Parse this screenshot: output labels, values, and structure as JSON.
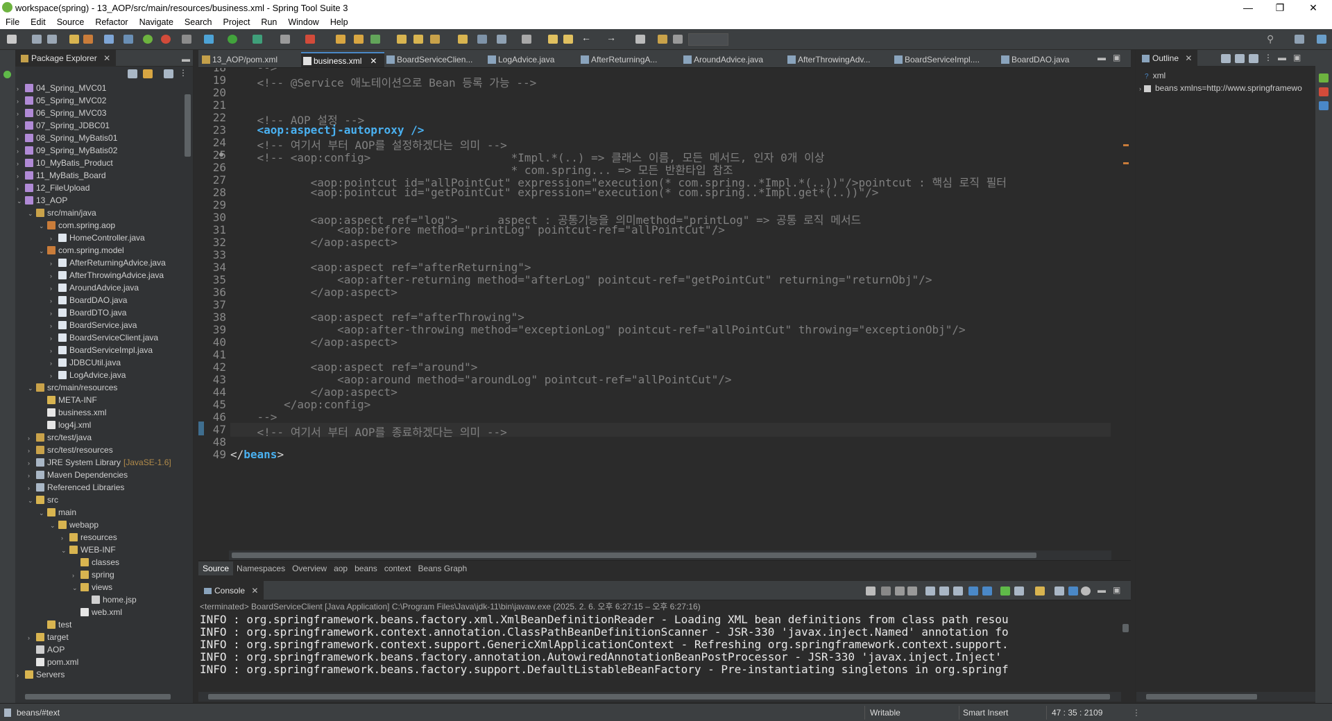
{
  "window": {
    "title": "workspace(spring) - 13_AOP/src/main/resources/business.xml - Spring Tool Suite 3"
  },
  "menu": [
    "File",
    "Edit",
    "Source",
    "Refactor",
    "Navigate",
    "Search",
    "Project",
    "Run",
    "Window",
    "Help"
  ],
  "package_explorer": {
    "title": "Package Explorer",
    "items": [
      {
        "label": "04_Spring_MVC01",
        "level": 0,
        "twisty": "›",
        "kind": "project"
      },
      {
        "label": "05_Spring_MVC02",
        "level": 0,
        "twisty": "›",
        "kind": "project"
      },
      {
        "label": "06_Spring_MVC03",
        "level": 0,
        "twisty": "›",
        "kind": "project"
      },
      {
        "label": "07_Spring_JDBC01",
        "level": 0,
        "twisty": "›",
        "kind": "project"
      },
      {
        "label": "08_Spring_MyBatis01",
        "level": 0,
        "twisty": "›",
        "kind": "project"
      },
      {
        "label": "09_Spring_MyBatis02",
        "level": 0,
        "twisty": "›",
        "kind": "project"
      },
      {
        "label": "10_MyBatis_Product",
        "level": 0,
        "twisty": "›",
        "kind": "project"
      },
      {
        "label": "11_MyBatis_Board",
        "level": 0,
        "twisty": "›",
        "kind": "project"
      },
      {
        "label": "12_FileUpload",
        "level": 0,
        "twisty": "›",
        "kind": "project"
      },
      {
        "label": "13_AOP",
        "level": 0,
        "twisty": "⌄",
        "kind": "project"
      },
      {
        "label": "src/main/java",
        "level": 1,
        "twisty": "⌄",
        "kind": "srcfolder"
      },
      {
        "label": "com.spring.aop",
        "level": 2,
        "twisty": "⌄",
        "kind": "package"
      },
      {
        "label": "HomeController.java",
        "level": 3,
        "twisty": "›",
        "kind": "java"
      },
      {
        "label": "com.spring.model",
        "level": 2,
        "twisty": "⌄",
        "kind": "package"
      },
      {
        "label": "AfterReturningAdvice.java",
        "level": 3,
        "twisty": "›",
        "kind": "java"
      },
      {
        "label": "AfterThrowingAdvice.java",
        "level": 3,
        "twisty": "›",
        "kind": "java"
      },
      {
        "label": "AroundAdvice.java",
        "level": 3,
        "twisty": "›",
        "kind": "java"
      },
      {
        "label": "BoardDAO.java",
        "level": 3,
        "twisty": "›",
        "kind": "java"
      },
      {
        "label": "BoardDTO.java",
        "level": 3,
        "twisty": "›",
        "kind": "java"
      },
      {
        "label": "BoardService.java",
        "level": 3,
        "twisty": "›",
        "kind": "java"
      },
      {
        "label": "BoardServiceClient.java",
        "level": 3,
        "twisty": "›",
        "kind": "java"
      },
      {
        "label": "BoardServiceImpl.java",
        "level": 3,
        "twisty": "›",
        "kind": "java"
      },
      {
        "label": "JDBCUtil.java",
        "level": 3,
        "twisty": "›",
        "kind": "java"
      },
      {
        "label": "LogAdvice.java",
        "level": 3,
        "twisty": "›",
        "kind": "java"
      },
      {
        "label": "src/main/resources",
        "level": 1,
        "twisty": "⌄",
        "kind": "srcfolder"
      },
      {
        "label": "META-INF",
        "level": 2,
        "twisty": "",
        "kind": "folder"
      },
      {
        "label": "business.xml",
        "level": 2,
        "twisty": "",
        "kind": "xml"
      },
      {
        "label": "log4j.xml",
        "level": 2,
        "twisty": "",
        "kind": "xml"
      },
      {
        "label": "src/test/java",
        "level": 1,
        "twisty": "›",
        "kind": "srcfolder"
      },
      {
        "label": "src/test/resources",
        "level": 1,
        "twisty": "›",
        "kind": "srcfolder"
      },
      {
        "label": "JRE System Library",
        "suffix": "[JavaSE-1.6]",
        "level": 1,
        "twisty": "›",
        "kind": "library"
      },
      {
        "label": "Maven Dependencies",
        "level": 1,
        "twisty": "›",
        "kind": "library"
      },
      {
        "label": "Referenced Libraries",
        "level": 1,
        "twisty": "›",
        "kind": "library"
      },
      {
        "label": "src",
        "level": 1,
        "twisty": "⌄",
        "kind": "folder"
      },
      {
        "label": "main",
        "level": 2,
        "twisty": "⌄",
        "kind": "folder"
      },
      {
        "label": "webapp",
        "level": 3,
        "twisty": "⌄",
        "kind": "folder"
      },
      {
        "label": "resources",
        "level": 4,
        "twisty": "›",
        "kind": "folder"
      },
      {
        "label": "WEB-INF",
        "level": 4,
        "twisty": "⌄",
        "kind": "folder"
      },
      {
        "label": "classes",
        "level": 5,
        "twisty": "",
        "kind": "folder"
      },
      {
        "label": "spring",
        "level": 5,
        "twisty": "›",
        "kind": "folder"
      },
      {
        "label": "views",
        "level": 5,
        "twisty": "⌄",
        "kind": "folder"
      },
      {
        "label": "home.jsp",
        "level": 6,
        "twisty": "",
        "kind": "file"
      },
      {
        "label": "web.xml",
        "level": 5,
        "twisty": "",
        "kind": "xml"
      },
      {
        "label": "test",
        "level": 2,
        "twisty": "",
        "kind": "folder"
      },
      {
        "label": "target",
        "level": 1,
        "twisty": "›",
        "kind": "folder"
      },
      {
        "label": "AOP",
        "level": 1,
        "twisty": "",
        "kind": "file"
      },
      {
        "label": "pom.xml",
        "level": 1,
        "twisty": "",
        "kind": "xml"
      },
      {
        "label": "Servers",
        "level": 0,
        "twisty": "›",
        "kind": "folder"
      }
    ]
  },
  "editor": {
    "tabs": [
      "13_AOP/pom.xml",
      "business.xml",
      "BoardServiceClien...",
      "LogAdvice.java",
      "AfterReturningA...",
      "AroundAdvice.java",
      "AfterThrowingAdv...",
      "BoardServiceImpl....",
      "BoardDAO.java"
    ],
    "active_tab": "business.xml",
    "lines": [
      {
        "n": "18",
        "t": "    -->",
        "c": "cm"
      },
      {
        "n": "19",
        "t": "    <!-- @Service 애노테이션으로 Bean 등록 가능 -->",
        "c": "cm"
      },
      {
        "n": "20",
        "t": "",
        "c": ""
      },
      {
        "n": "21",
        "t": "",
        "c": ""
      },
      {
        "n": "22",
        "t": "    <!-- AOP 설정 -->",
        "c": "cm"
      },
      {
        "n": "23",
        "t": "    <aop:aspectj-autoproxy />",
        "c": "tg"
      },
      {
        "n": "24",
        "t": "    <!-- 여기서 부터 AOP를 설정하겠다는 의미 -->",
        "c": "cm"
      },
      {
        "n": "25",
        "t": "    <!-- <aop:config>                     *Impl.*(..) => 클래스 이름, 모든 메서드, 인자 0개 이상",
        "c": "cm"
      },
      {
        "n": "26",
        "t": "                                          * com.spring... => 모든 반환타입 참조",
        "c": "cm"
      },
      {
        "n": "27",
        "t": "            <aop:pointcut id=\"allPointCut\" expression=\"execution(* com.spring..*Impl.*(..))\"/>pointcut : 핵심 로직 필터",
        "c": "cm"
      },
      {
        "n": "28",
        "t": "            <aop:pointcut id=\"getPointCut\" expression=\"execution(* com.spring..*Impl.get*(..))\"/>",
        "c": "cm"
      },
      {
        "n": "29",
        "t": "",
        "c": ""
      },
      {
        "n": "30",
        "t": "            <aop:aspect ref=\"log\">      aspect : 공통기능을 의미method=\"printLog\" => 공통 로직 메서드",
        "c": "cm"
      },
      {
        "n": "31",
        "t": "                <aop:before method=\"printLog\" pointcut-ref=\"allPointCut\"/>",
        "c": "cm"
      },
      {
        "n": "32",
        "t": "            </aop:aspect>",
        "c": "cm"
      },
      {
        "n": "33",
        "t": "",
        "c": ""
      },
      {
        "n": "34",
        "t": "            <aop:aspect ref=\"afterReturning\">",
        "c": "cm"
      },
      {
        "n": "35",
        "t": "                <aop:after-returning method=\"afterLog\" pointcut-ref=\"getPointCut\" returning=\"returnObj\"/>",
        "c": "cm"
      },
      {
        "n": "36",
        "t": "            </aop:aspect>",
        "c": "cm"
      },
      {
        "n": "37",
        "t": "",
        "c": ""
      },
      {
        "n": "38",
        "t": "            <aop:aspect ref=\"afterThrowing\">",
        "c": "cm"
      },
      {
        "n": "39",
        "t": "                <aop:after-throwing method=\"exceptionLog\" pointcut-ref=\"allPointCut\" throwing=\"exceptionObj\"/>",
        "c": "cm"
      },
      {
        "n": "40",
        "t": "            </aop:aspect>",
        "c": "cm"
      },
      {
        "n": "41",
        "t": "",
        "c": ""
      },
      {
        "n": "42",
        "t": "            <aop:aspect ref=\"around\">",
        "c": "cm"
      },
      {
        "n": "43",
        "t": "                <aop:around method=\"aroundLog\" pointcut-ref=\"allPointCut\"/>",
        "c": "cm"
      },
      {
        "n": "44",
        "t": "            </aop:aspect>",
        "c": "cm"
      },
      {
        "n": "45",
        "t": "        </aop:config>",
        "c": "cm"
      },
      {
        "n": "46",
        "t": "    -->",
        "c": "cm"
      },
      {
        "n": "47",
        "t": "    <!-- 여기서 부터 AOP를 종료하겠다는 의미 -->",
        "c": "cm"
      },
      {
        "n": "48",
        "t": "",
        "c": ""
      },
      {
        "n": "49",
        "t": "</beans>",
        "c": "end"
      }
    ],
    "subtabs": [
      "Source",
      "Namespaces",
      "Overview",
      "aop",
      "beans",
      "context",
      "Beans Graph"
    ]
  },
  "console": {
    "title": "Console",
    "terminated": "<terminated> BoardServiceClient [Java Application] C:\\Program Files\\Java\\jdk-11\\bin\\javaw.exe  (2025. 2. 6. 오후 6:27:15 – 오후 6:27:16)",
    "lines": [
      "INFO : org.springframework.beans.factory.xml.XmlBeanDefinitionReader - Loading XML bean definitions from class path resou",
      "INFO : org.springframework.context.annotation.ClassPathBeanDefinitionScanner - JSR-330 'javax.inject.Named' annotation fo",
      "INFO : org.springframework.context.support.GenericXmlApplicationContext - Refreshing org.springframework.context.support.",
      "INFO : org.springframework.beans.factory.annotation.AutowiredAnnotationBeanPostProcessor - JSR-330 'javax.inject.Inject'",
      "INFO : org.springframework.beans.factory.support.DefaultListableBeanFactory - Pre-instantiating singletons in org.springf"
    ]
  },
  "outline": {
    "title": "Outline",
    "items": [
      "xml",
      "beans xmlns=http://www.springframewo"
    ]
  },
  "status": {
    "path": "beans/#text",
    "writable": "Writable",
    "insert": "Smart Insert",
    "position": "47 : 35 : 2109"
  }
}
